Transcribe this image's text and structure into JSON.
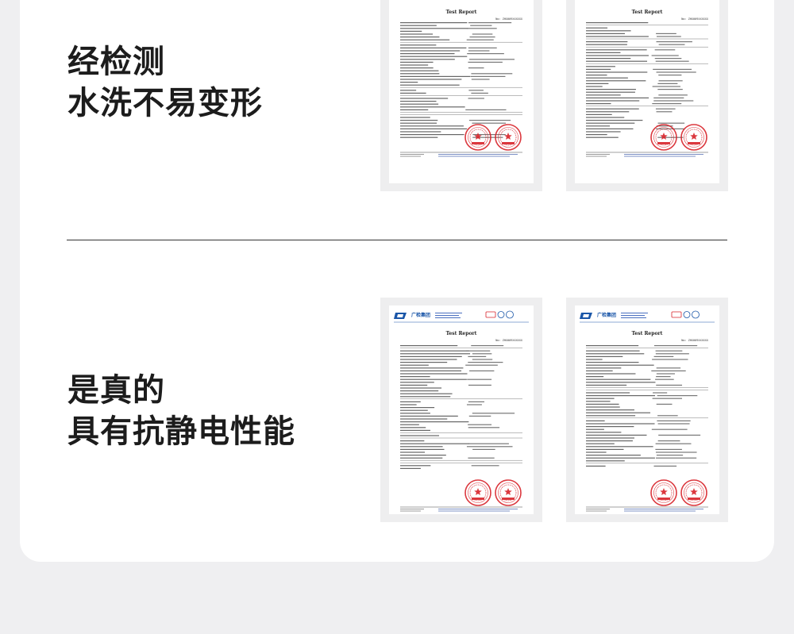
{
  "section_top": {
    "line1": "经检测",
    "line2": "水洗不易变形"
  },
  "section_bottom": {
    "line1": "是真的",
    "line2": "具有抗静电性能"
  },
  "reports": [
    {
      "title": "Test Report",
      "number": "No: ZHX009XXXXXX",
      "has_logo": false
    },
    {
      "title": "Test Report",
      "number": "No: ZHX009XXXXXX",
      "has_logo": false
    },
    {
      "title": "Test Report",
      "number": "No: ZHX009XXXXXX",
      "has_logo": true,
      "logo_text": "广检集团"
    },
    {
      "title": "Test Report",
      "number": "No: ZHX009XXXXXX",
      "has_logo": true,
      "logo_text": "广检集团"
    }
  ],
  "colors": {
    "stamp_red": "#d8232a",
    "logo_blue": "#1a56a8",
    "heading": "#1c1c1c"
  }
}
